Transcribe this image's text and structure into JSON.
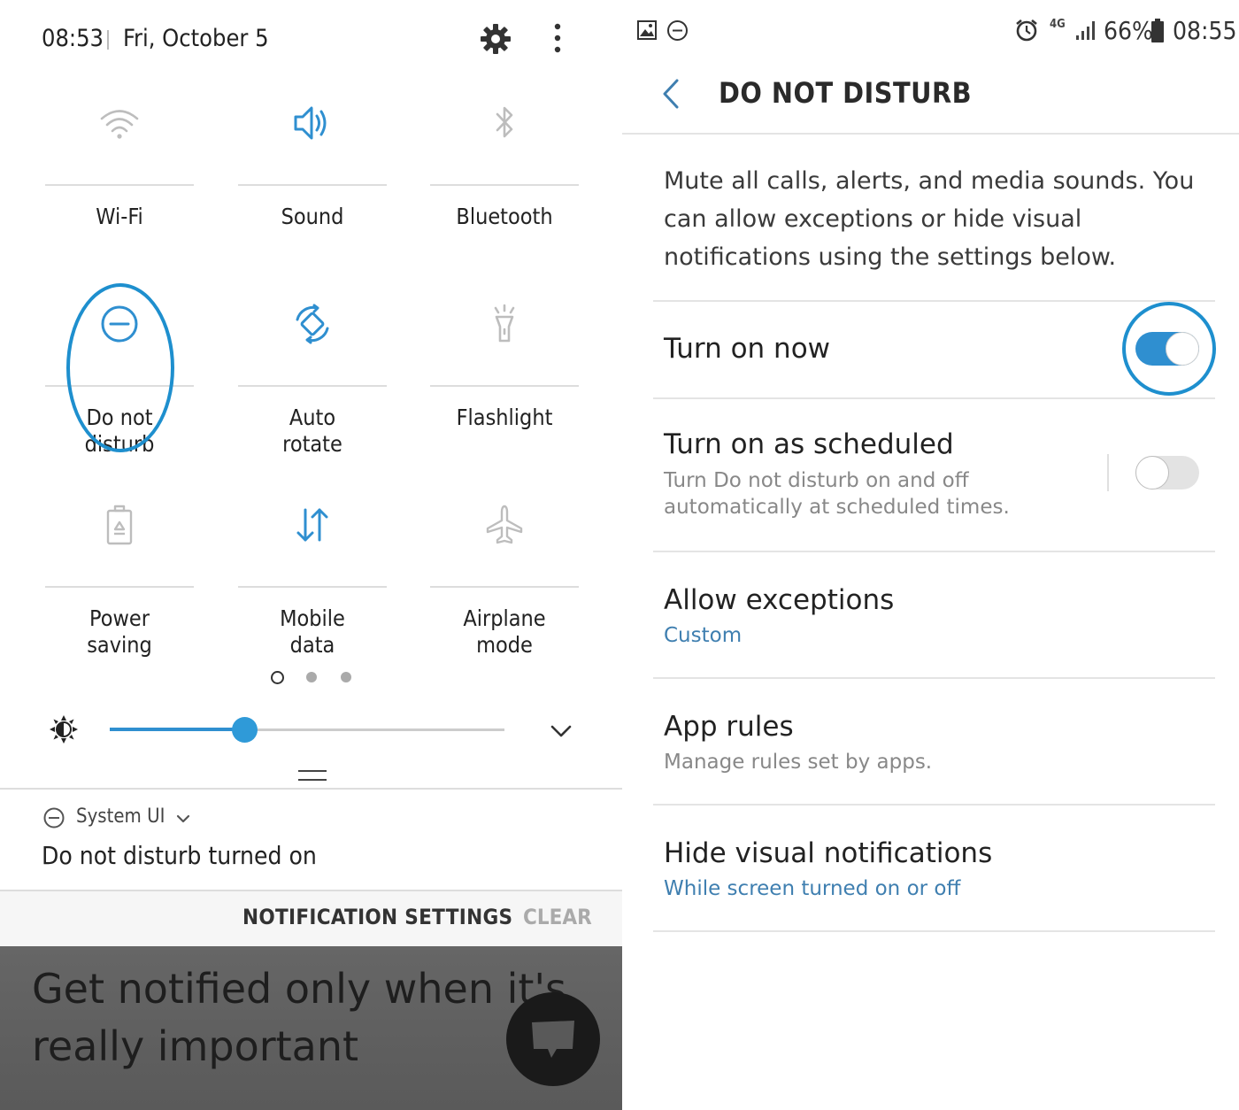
{
  "left_panel": {
    "time": "08:53",
    "date": "Fri, October 5",
    "tiles": [
      {
        "label": "Wi-Fi",
        "icon": "wifi-icon"
      },
      {
        "label": "Sound",
        "icon": "sound-icon"
      },
      {
        "label": "Bluetooth",
        "icon": "bluetooth-icon"
      },
      {
        "label_line1": "Do not",
        "label_line2": "disturb",
        "icon": "do-not-disturb-icon"
      },
      {
        "label_line1": "Auto",
        "label_line2": "rotate",
        "icon": "auto-rotate-icon"
      },
      {
        "label": "Flashlight",
        "icon": "flashlight-icon"
      },
      {
        "label_line1": "Power",
        "label_line2": "saving",
        "icon": "power-saving-icon"
      },
      {
        "label_line1": "Mobile",
        "label_line2": "data",
        "icon": "mobile-data-icon"
      },
      {
        "label_line1": "Airplane",
        "label_line2": "mode",
        "icon": "airplane-icon"
      }
    ],
    "brightness_level": 0.34,
    "notification": {
      "source": "System UI",
      "text": "Do not disturb turned on"
    },
    "buttons": {
      "notification_settings": "NOTIFICATION SETTINGS",
      "clear": "CLEAR"
    },
    "promo": {
      "line1": "Get notified only when it's",
      "line2": "really important"
    }
  },
  "right_panel": {
    "status": {
      "battery": "66%",
      "time": "08:55",
      "network": "4G"
    },
    "title": "DO NOT DISTURB",
    "description": "Mute all calls, alerts, and media sounds. You can allow exceptions or hide visual notifications using the settings below.",
    "rows": [
      {
        "title": "Turn on now",
        "toggle": true
      },
      {
        "title": "Turn on as scheduled",
        "subtitle": "Turn Do not disturb on and off automatically at scheduled times.",
        "toggle": false
      },
      {
        "title": "Allow exceptions",
        "subtitle": "Custom"
      },
      {
        "title": "App rules",
        "subtitle": "Manage rules set by apps."
      },
      {
        "title": "Hide visual notifications",
        "subtitle": "While screen turned on or off"
      }
    ]
  },
  "colors": {
    "accent": "#2f8fd0",
    "highlight_ring": "#1e8fce",
    "inactive_icon": "#b5b5b5"
  }
}
